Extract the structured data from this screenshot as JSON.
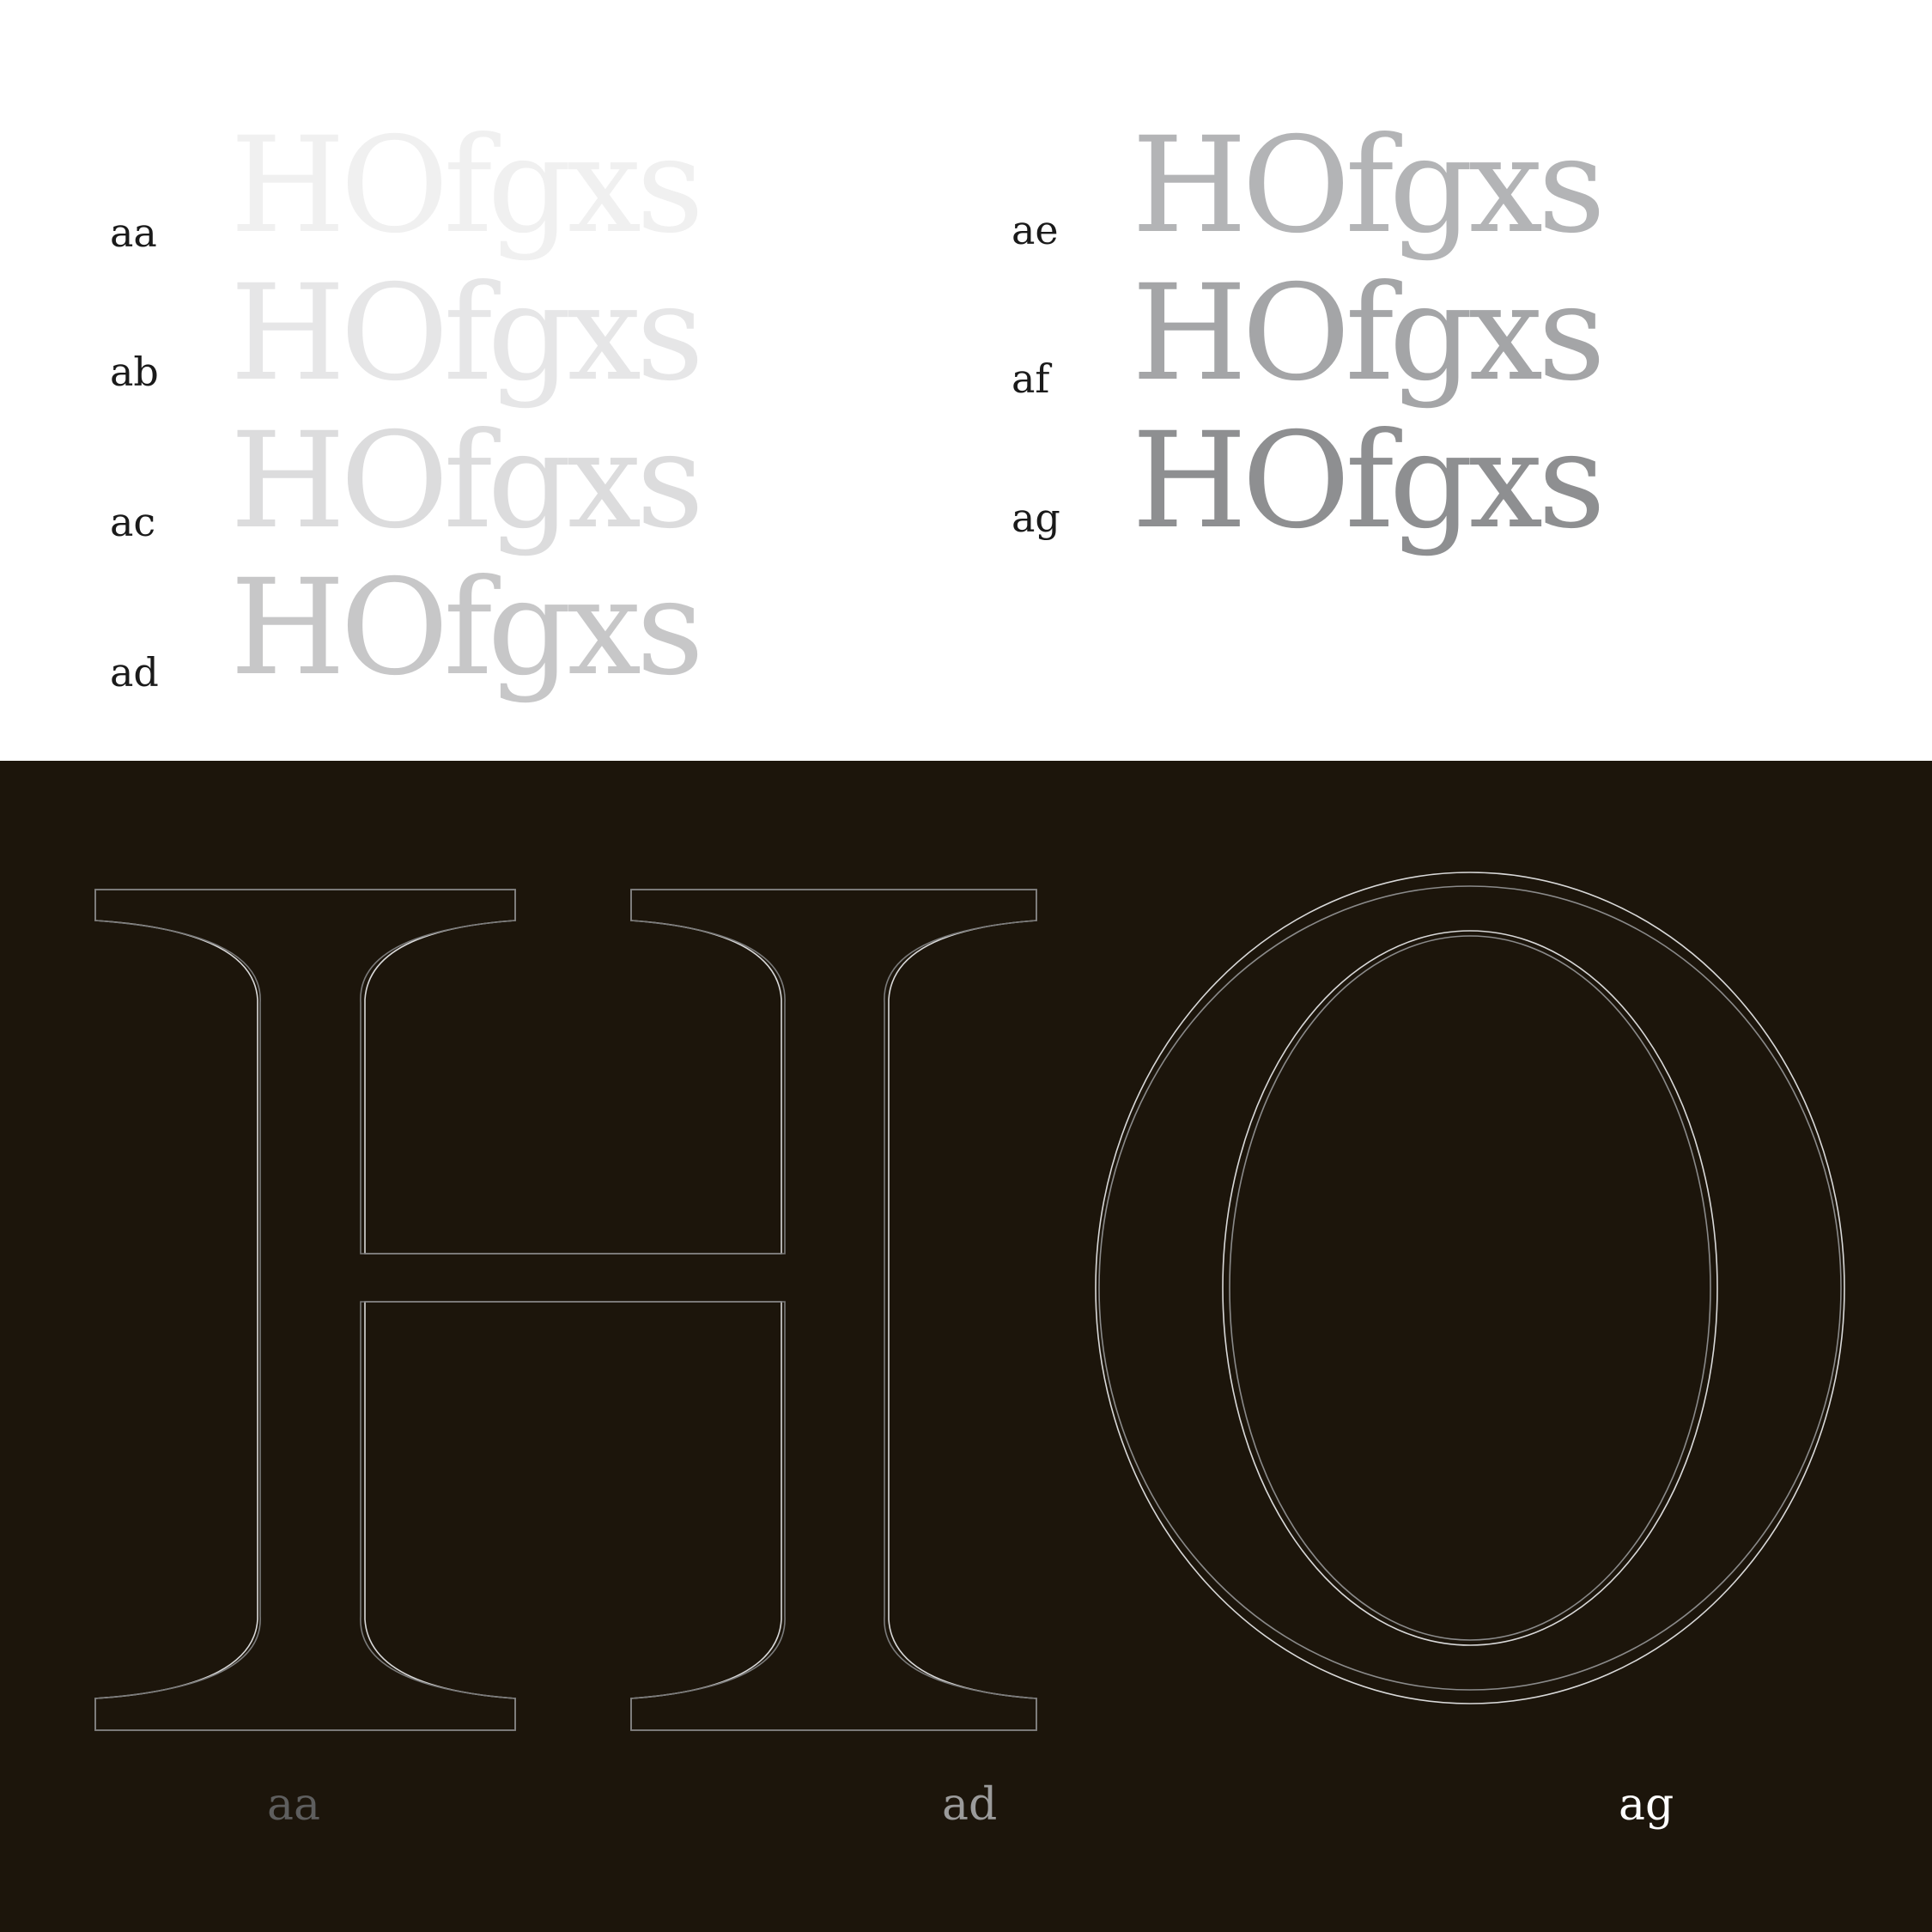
{
  "specimen_text": "HOfgxs",
  "weights_left": [
    {
      "label": "aa",
      "color": "#f0f0f0"
    },
    {
      "label": "ab",
      "color": "#e6e6e7"
    },
    {
      "label": "ac",
      "color": "#dcdcdd"
    },
    {
      "label": "ad",
      "color": "#c7c7c8"
    }
  ],
  "weights_right": [
    {
      "label": "ae",
      "color": "#b3b4b6"
    },
    {
      "label": "af",
      "color": "#a4a5a7"
    },
    {
      "label": "ag",
      "color": "#8e8f91"
    }
  ],
  "overlay": {
    "glyphs": "HO",
    "background": "#1c150b",
    "labels": [
      {
        "text": "aa",
        "color": "#5e5e5e"
      },
      {
        "text": "ad",
        "color": "#9b9b9b"
      },
      {
        "text": "ag",
        "color": "#ffffff"
      }
    ]
  }
}
